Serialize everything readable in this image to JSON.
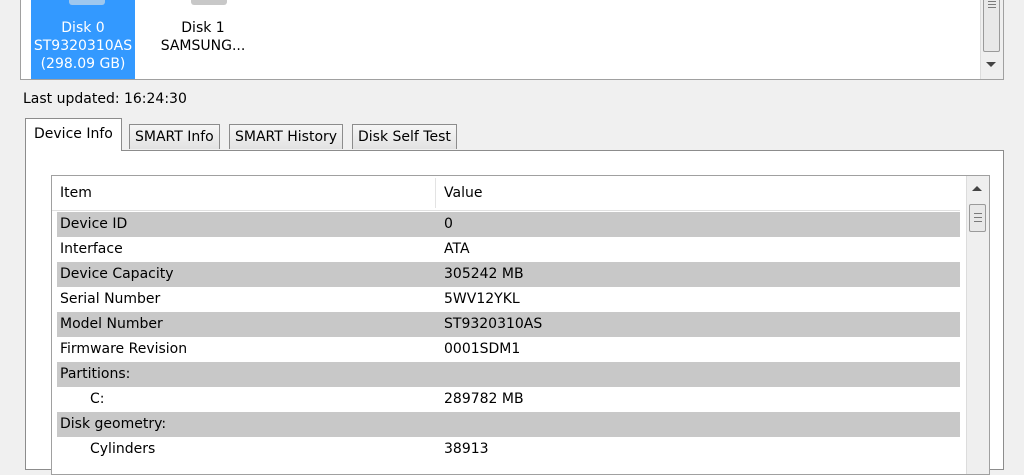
{
  "disks": [
    {
      "line1": "Disk 0",
      "line2": "ST9320310AS",
      "line3": "(298.09 GB)",
      "selected": true
    },
    {
      "line1": "Disk 1",
      "line2": "SAMSUNG...",
      "line3": "",
      "selected": false
    }
  ],
  "status": {
    "last_updated": "Last updated: 16:24:30"
  },
  "tabs": [
    {
      "label": "Device Info",
      "active": true
    },
    {
      "label": "SMART Info",
      "active": false
    },
    {
      "label": "SMART History",
      "active": false
    },
    {
      "label": "Disk Self Test",
      "active": false
    }
  ],
  "table": {
    "headers": [
      "Item",
      "Value"
    ],
    "rows": [
      {
        "item": "Device ID",
        "value": "0"
      },
      {
        "item": "Interface",
        "value": "ATA"
      },
      {
        "item": "Device Capacity",
        "value": "305242 MB"
      },
      {
        "item": "Serial Number",
        "value": "5WV12YKL"
      },
      {
        "item": "Model Number",
        "value": "ST9320310AS"
      },
      {
        "item": "Firmware Revision",
        "value": "0001SDM1"
      },
      {
        "item": "Partitions:",
        "value": ""
      },
      {
        "item": "C:",
        "value": "289782 MB"
      },
      {
        "item": "Disk geometry:",
        "value": ""
      },
      {
        "item": "Cylinders",
        "value": "38913"
      }
    ]
  },
  "icons": {
    "disk": "hard-disk-icon",
    "scroll_up": "arrow-up-icon",
    "scroll_down": "arrow-down-icon"
  },
  "colors": {
    "selection": "#3399ff",
    "stripe": "#c8c8c8"
  }
}
